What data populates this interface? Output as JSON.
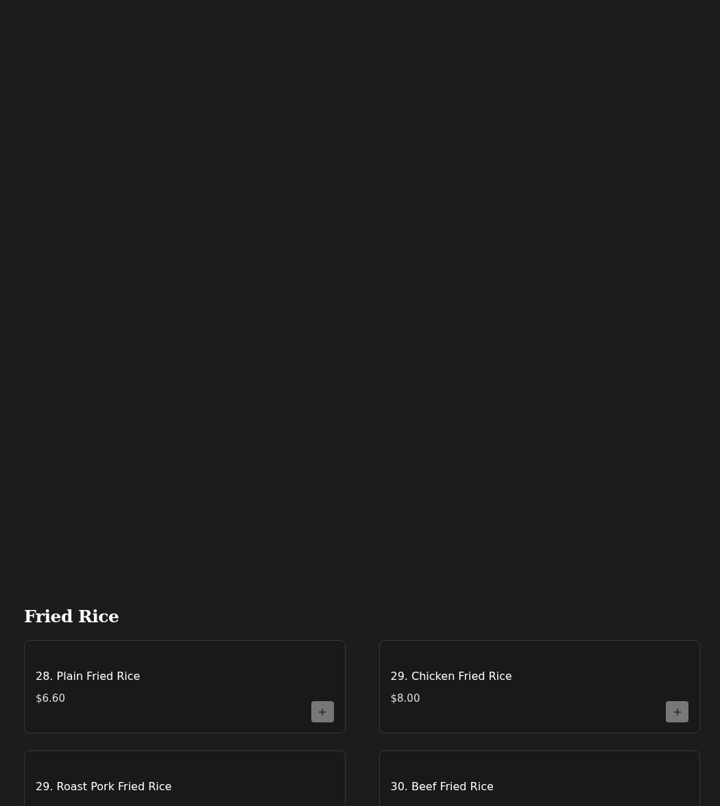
{
  "section": {
    "title": "Fried Rice",
    "items": [
      {
        "name": "28. Plain Fried Rice",
        "price": "$6.60",
        "add_button": true
      },
      {
        "name": "29. Chicken Fried Rice",
        "price": "$8.00",
        "add_button": true
      },
      {
        "name": "29. Roast Pork Fried Rice"
      },
      {
        "name": "30. Beef Fried Rice"
      }
    ]
  }
}
